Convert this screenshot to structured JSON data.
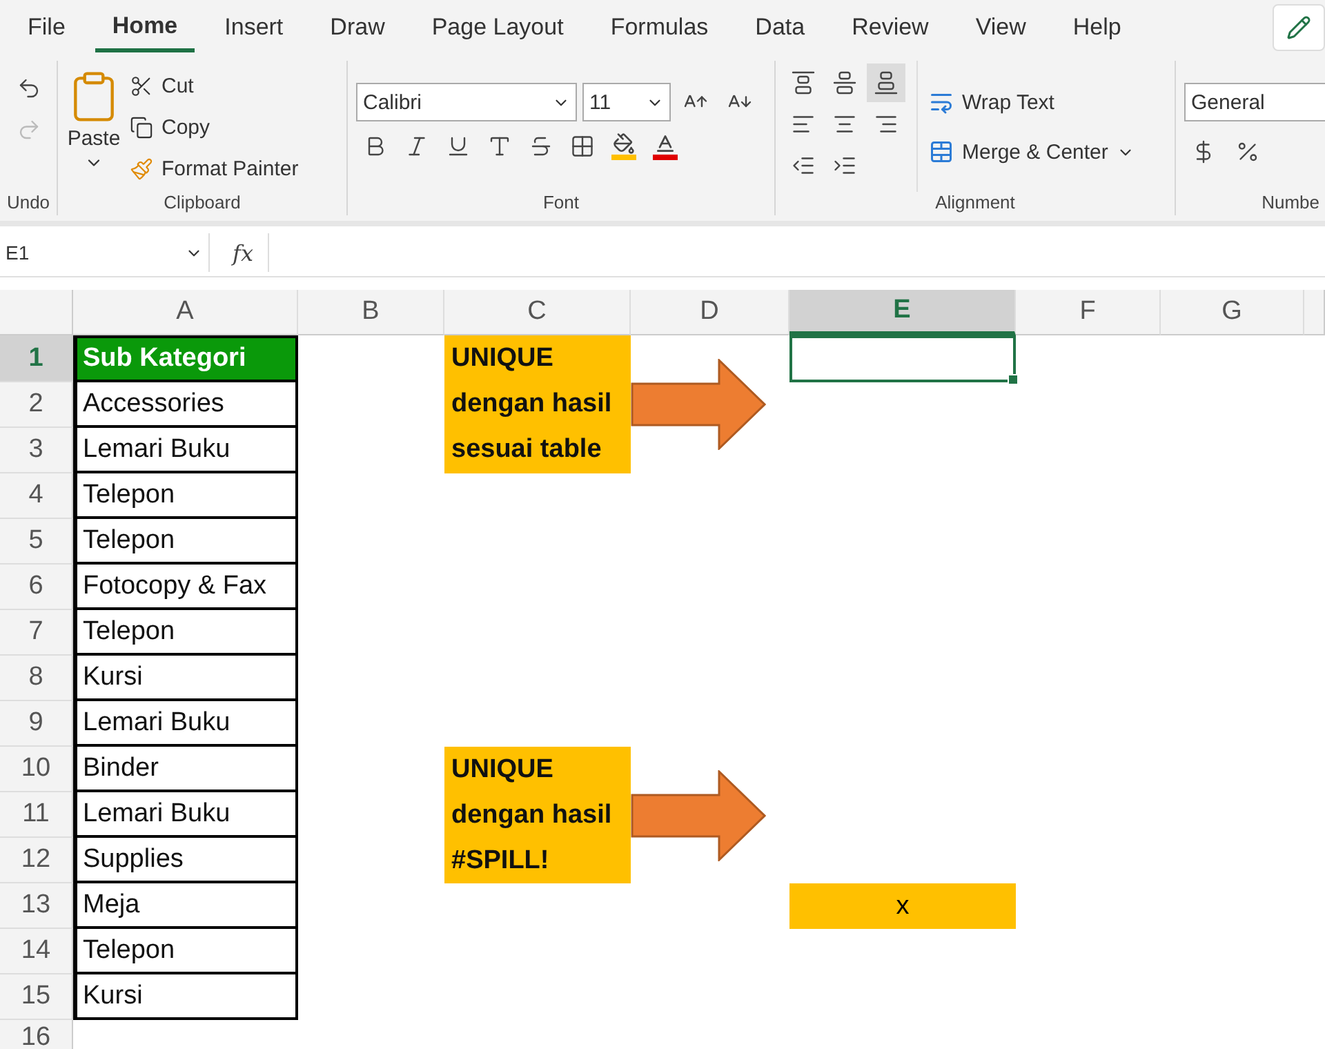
{
  "tabs": [
    {
      "label": "File",
      "selected": false
    },
    {
      "label": "Home",
      "selected": true
    },
    {
      "label": "Insert",
      "selected": false
    },
    {
      "label": "Draw",
      "selected": false
    },
    {
      "label": "Page Layout",
      "selected": false
    },
    {
      "label": "Formulas",
      "selected": false
    },
    {
      "label": "Data",
      "selected": false
    },
    {
      "label": "Review",
      "selected": false
    },
    {
      "label": "View",
      "selected": false
    },
    {
      "label": "Help",
      "selected": false
    }
  ],
  "ribbon": {
    "undo": {
      "label": "Undo",
      "redo_disabled": true
    },
    "clipboard": {
      "label": "Clipboard",
      "paste": "Paste",
      "actions": [
        "Cut",
        "Copy",
        "Format Painter"
      ]
    },
    "font": {
      "label": "Font",
      "name": "Calibri",
      "size": "11"
    },
    "alignment": {
      "label": "Alignment",
      "vertical": [
        {
          "selected": false
        },
        {
          "selected": false
        },
        {
          "selected": true
        }
      ],
      "wrap_text": "Wrap Text",
      "merge": "Merge & Center"
    },
    "number": {
      "label": "Numbe",
      "format": "General"
    }
  },
  "formula_bar": {
    "name_box": "E1",
    "function_label": "fx"
  },
  "columns": [
    {
      "label": "A",
      "selected": false
    },
    {
      "label": "B",
      "selected": false
    },
    {
      "label": "C",
      "selected": false
    },
    {
      "label": "D",
      "selected": false
    },
    {
      "label": "E",
      "selected": true
    },
    {
      "label": "F",
      "selected": false
    },
    {
      "label": "G",
      "selected": false
    }
  ],
  "rows": [
    {
      "number": "1",
      "selected": true,
      "kind": "header",
      "a": "Sub Kategori"
    },
    {
      "number": "2",
      "selected": false,
      "kind": "data",
      "a": "Accessories"
    },
    {
      "number": "3",
      "selected": false,
      "kind": "data",
      "a": "Lemari Buku"
    },
    {
      "number": "4",
      "selected": false,
      "kind": "data",
      "a": "Telepon"
    },
    {
      "number": "5",
      "selected": false,
      "kind": "data",
      "a": "Telepon"
    },
    {
      "number": "6",
      "selected": false,
      "kind": "data",
      "a": "Fotocopy & Fax"
    },
    {
      "number": "7",
      "selected": false,
      "kind": "data",
      "a": "Telepon"
    },
    {
      "number": "8",
      "selected": false,
      "kind": "data",
      "a": "Kursi"
    },
    {
      "number": "9",
      "selected": false,
      "kind": "data",
      "a": "Lemari Buku"
    },
    {
      "number": "10",
      "selected": false,
      "kind": "data",
      "a": "Binder"
    },
    {
      "number": "11",
      "selected": false,
      "kind": "data",
      "a": "Lemari Buku"
    },
    {
      "number": "12",
      "selected": false,
      "kind": "data",
      "a": "Supplies"
    },
    {
      "number": "13",
      "selected": false,
      "kind": "data",
      "a": "Meja"
    },
    {
      "number": "14",
      "selected": false,
      "kind": "data",
      "a": "Telepon"
    },
    {
      "number": "15",
      "selected": false,
      "kind": "data",
      "a": "Kursi"
    },
    {
      "number": "16",
      "selected": false,
      "kind": "empty"
    }
  ],
  "callouts": [
    "UNIQUE\ndengan hasil\nsesuai table",
    "UNIQUE\ndengan hasil\n#SPILL!"
  ],
  "highlight_cell": {
    "text": "x"
  }
}
